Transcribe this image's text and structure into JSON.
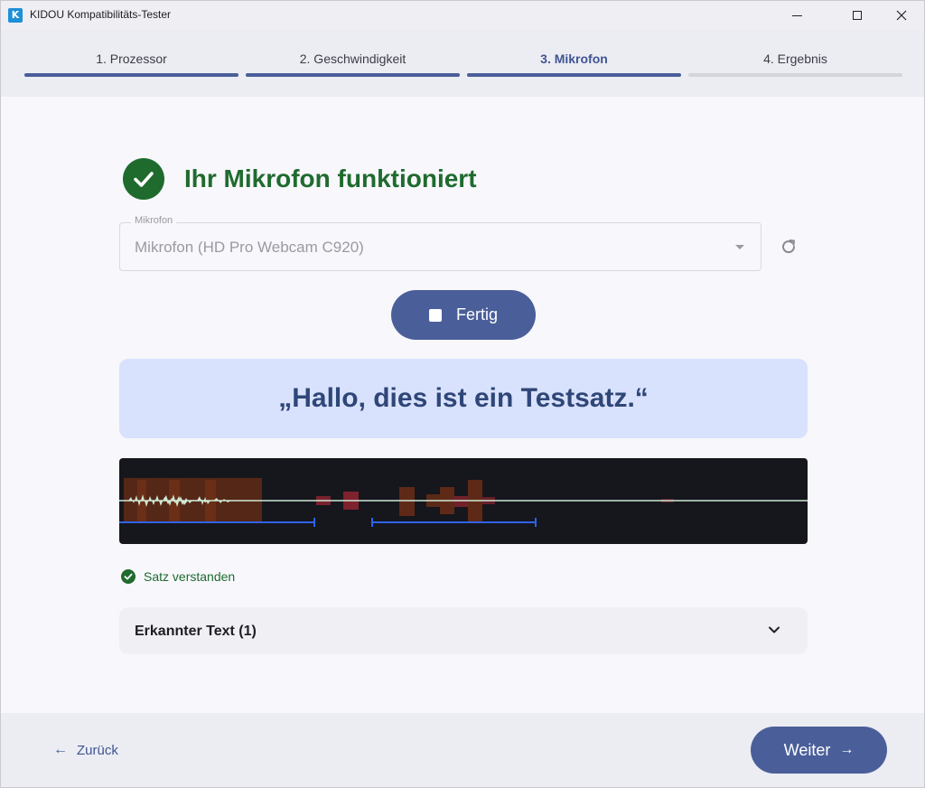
{
  "window": {
    "title": "KIDOU Kompatibilitäts-Tester",
    "app_icon": "kidou-logo-icon",
    "controls": [
      "minimize-icon",
      "maximize-icon",
      "close-icon"
    ]
  },
  "stepper": {
    "steps": [
      {
        "label": "1. Prozessor",
        "state": "done"
      },
      {
        "label": "2. Geschwindigkeit",
        "state": "done"
      },
      {
        "label": "3. Mikrofon",
        "state": "active"
      },
      {
        "label": "4. Ergebnis",
        "state": "pending"
      }
    ]
  },
  "status": {
    "title": "Ihr Mikrofon funktioniert",
    "icon": "check-circle-icon"
  },
  "microphone": {
    "field_label": "Mikrofon",
    "selected": "Mikrofon (HD Pro Webcam C920)",
    "refresh_icon": "refresh-icon"
  },
  "record_button": {
    "label": "Fertig",
    "icon": "stop-icon"
  },
  "test_sentence": "„Hallo, dies ist ein Testsatz.“",
  "recognition": {
    "status_text": "Satz verstanden",
    "recognized_label": "Erkannter Text (1)"
  },
  "footer": {
    "back_label": "Zurück",
    "next_label": "Weiter"
  },
  "colors": {
    "primary": "#4a5f99",
    "success": "#1f6b2e",
    "sentence_bg": "#d9e2fc",
    "waveform_bg": "#16161d",
    "waveform_line": "#cfe8d4",
    "speech_marker": "#2f63e8"
  }
}
